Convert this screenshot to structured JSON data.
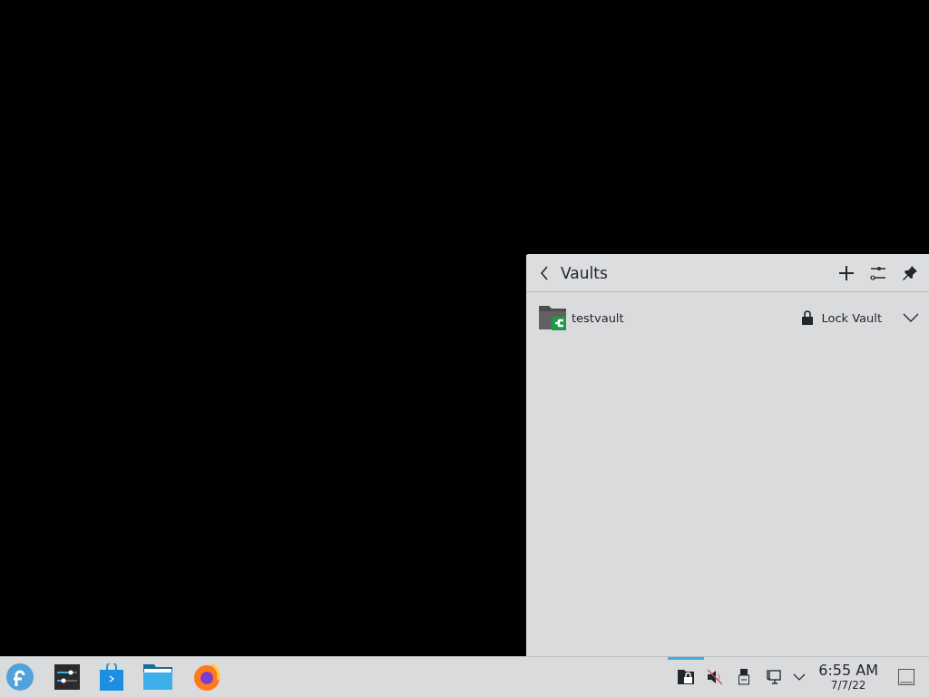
{
  "popup": {
    "title": "Vaults",
    "vaults": [
      {
        "name": "testvault",
        "action": "Lock Vault",
        "expanded": false
      }
    ]
  },
  "taskbar": {
    "launchers": [
      {
        "kind": "fedora"
      },
      {
        "kind": "settings"
      },
      {
        "kind": "store"
      },
      {
        "kind": "files"
      },
      {
        "kind": "browser"
      }
    ],
    "tray": [
      {
        "kind": "vault",
        "selected": true
      },
      {
        "kind": "volume",
        "selected": false
      },
      {
        "kind": "usb",
        "selected": false
      },
      {
        "kind": "network",
        "selected": false
      }
    ],
    "clock": {
      "time": "6:55 AM",
      "date": "7/7/22"
    }
  }
}
